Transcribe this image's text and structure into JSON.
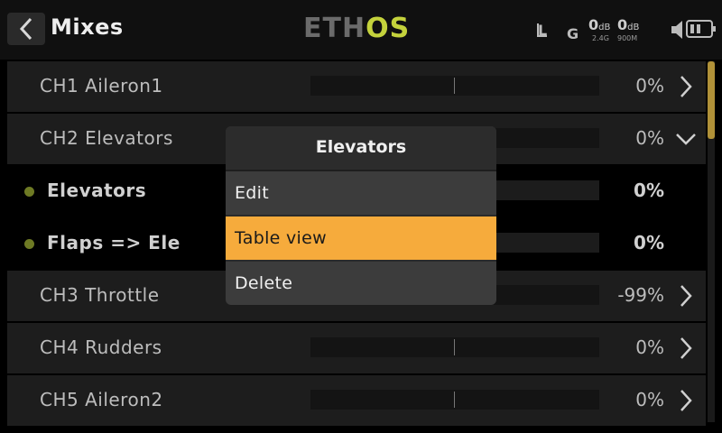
{
  "header": {
    "title": "Mixes",
    "logo_part1": "ETH",
    "logo_part2": "OS",
    "status": {
      "switch_l": "L",
      "switch_g": "G",
      "rssi1_value": "0",
      "rssi1_unit": "dB",
      "rssi1_band": "2.4G",
      "rssi2_value": "0",
      "rssi2_unit": "dB",
      "rssi2_band": "900M"
    }
  },
  "rows": [
    {
      "label": "CH1  Aileron1",
      "value": "0%",
      "kind": "channel",
      "chevron": "right"
    },
    {
      "label": "CH2  Elevators",
      "value": "0%",
      "kind": "channel",
      "chevron": "down"
    },
    {
      "label": "Elevators",
      "value": "0%",
      "kind": "child",
      "chevron": "none"
    },
    {
      "label": "Flaps => Ele",
      "value": "0%",
      "kind": "child",
      "chevron": "none"
    },
    {
      "label": "CH3  Throttle",
      "value": "-99%",
      "kind": "channel",
      "chevron": "right"
    },
    {
      "label": "CH4  Rudders",
      "value": "0%",
      "kind": "channel",
      "chevron": "right"
    },
    {
      "label": "CH5  Aileron2",
      "value": "0%",
      "kind": "channel",
      "chevron": "right"
    }
  ],
  "dialog": {
    "title": "Elevators",
    "items": [
      {
        "label": "Edit",
        "selected": false
      },
      {
        "label": "Table view",
        "selected": true
      },
      {
        "label": "Delete",
        "selected": false
      }
    ]
  },
  "colors": {
    "accent": "#f6ab3c",
    "logo_accent": "#c4d23c",
    "scroll_thumb": "#b09138",
    "dot": "#6e7a24"
  }
}
